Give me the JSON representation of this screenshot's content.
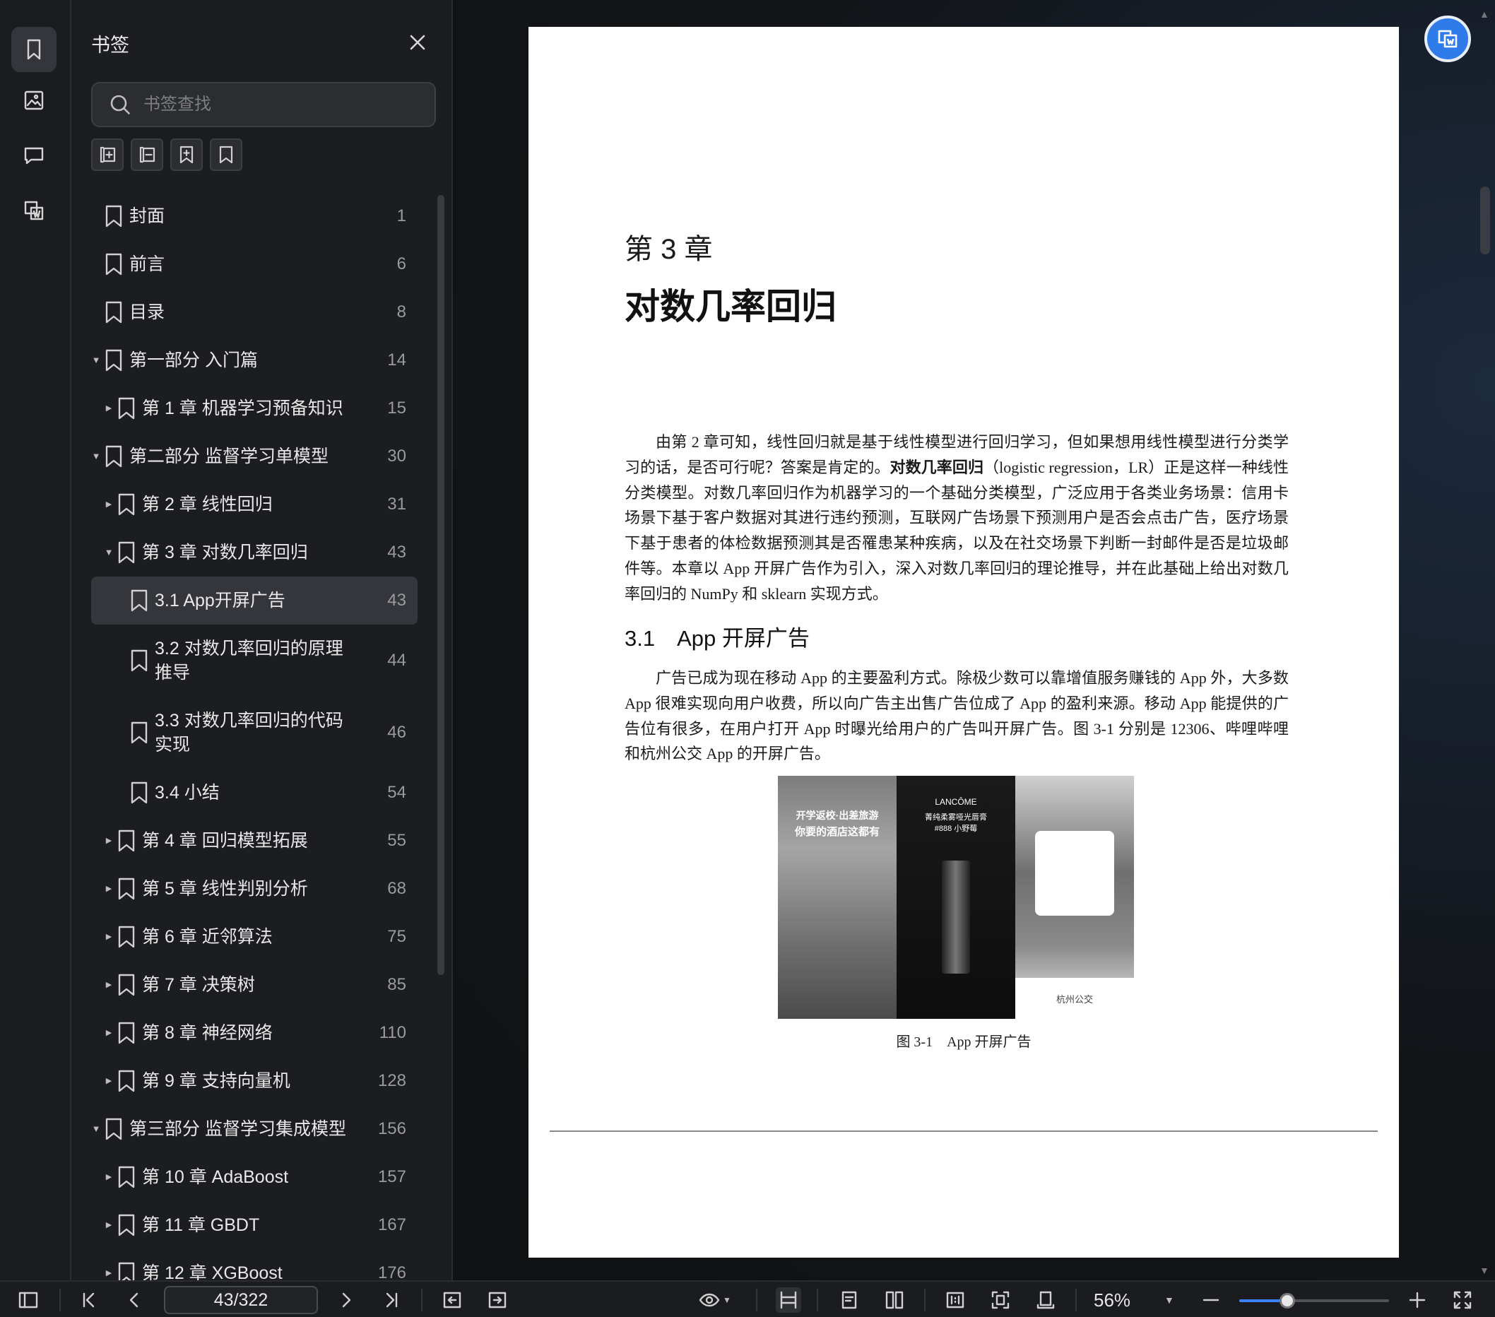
{
  "panel": {
    "title": "书签",
    "search_placeholder": "书签查找",
    "tools": [
      "expand-all-icon",
      "collapse-all-icon",
      "add-bookmark-icon",
      "bookmark-icon"
    ]
  },
  "bookmarks": [
    {
      "label": "封面",
      "page": "1",
      "level": 0,
      "arrow": ""
    },
    {
      "label": "前言",
      "page": "6",
      "level": 0,
      "arrow": ""
    },
    {
      "label": "目录",
      "page": "8",
      "level": 0,
      "arrow": ""
    },
    {
      "label": "第一部分 入门篇",
      "page": "14",
      "level": 0,
      "arrow": "down"
    },
    {
      "label": "第 1 章 机器学习预备知识",
      "page": "15",
      "level": 1,
      "arrow": "right"
    },
    {
      "label": "第二部分 监督学习单模型",
      "page": "30",
      "level": 0,
      "arrow": "down"
    },
    {
      "label": "第 2 章 线性回归",
      "page": "31",
      "level": 1,
      "arrow": "right"
    },
    {
      "label": "第 3 章 对数几率回归",
      "page": "43",
      "level": 1,
      "arrow": "down"
    },
    {
      "label": "3.1 App开屏广告",
      "page": "43",
      "level": 2,
      "arrow": "",
      "selected": true
    },
    {
      "label": "3.2 对数几率回归的原理推导",
      "page": "44",
      "level": 2,
      "arrow": "",
      "tall": true
    },
    {
      "label": "3.3 对数几率回归的代码实现",
      "page": "46",
      "level": 2,
      "arrow": "",
      "tall": true
    },
    {
      "label": "3.4 小结",
      "page": "54",
      "level": 2,
      "arrow": ""
    },
    {
      "label": "第 4 章 回归模型拓展",
      "page": "55",
      "level": 1,
      "arrow": "right"
    },
    {
      "label": "第 5 章 线性判别分析",
      "page": "68",
      "level": 1,
      "arrow": "right"
    },
    {
      "label": "第 6 章 近邻算法",
      "page": "75",
      "level": 1,
      "arrow": "right"
    },
    {
      "label": "第 7 章 决策树",
      "page": "85",
      "level": 1,
      "arrow": "right"
    },
    {
      "label": "第 8 章 神经网络",
      "page": "110",
      "level": 1,
      "arrow": "right"
    },
    {
      "label": "第 9 章 支持向量机",
      "page": "128",
      "level": 1,
      "arrow": "right"
    },
    {
      "label": "第三部分 监督学习集成模型",
      "page": "156",
      "level": 0,
      "arrow": "down"
    },
    {
      "label": "第 10 章 AdaBoost",
      "page": "157",
      "level": 1,
      "arrow": "right"
    },
    {
      "label": "第 11 章 GBDT",
      "page": "167",
      "level": 1,
      "arrow": "right"
    },
    {
      "label": "第 12 章 XGBoost",
      "page": "176",
      "level": 1,
      "arrow": "right"
    }
  ],
  "document": {
    "chapter_number": "第 3 章",
    "chapter_title": "对数几率回归",
    "para1_a": "由第 2 章可知，线性回归就是基于线性模型进行回归学习，但如果想用线性模型进行分类学习的话，是否可行呢？答案是肯定的。",
    "para1_bold": "对数几率回归",
    "para1_b": "（logistic regression，LR）正是这样一种线性分类模型。对数几率回归作为机器学习的一个基础分类模型，广泛应用于各类业务场景：信用卡场景下基于客户数据对其进行违约预测，互联网广告场景下预测用户是否会点击广告，医疗场景下基于患者的体检数据预测其是否罹患某种疾病，以及在社交场景下判断一封邮件是否是垃圾邮件等。本章以 App 开屏广告作为引入，深入对数几率回归的理论推导，并在此基础上给出对数几率回归的 NumPy 和 sklearn 实现方式。",
    "section_title": "3.1　App 开屏广告",
    "para2": "广告已成为现在移动 App 的主要盈利方式。除极少数可以靠增值服务赚钱的 App 外，大多数 App 很难实现向用户收费，所以向广告主出售广告位成了 App 的盈利来源。移动 App 能提供的广告位有很多，在用户打开 App 时曝光给用户的广告叫开屏广告。图 3-1 分别是 12306、哔哩哔哩和杭州公交 App 的开屏广告。",
    "figure_caption": "图 3-1　App 开屏广告",
    "ad1_line1": "开学返校·出差旅游",
    "ad1_line2": "你要的酒店这都有",
    "ad2_brand": "LANCÔME",
    "ad2_line1": "菁纯柔雾哑光唇膏",
    "ad2_line2": "#888 小野莓",
    "ad3_label": "杭州公交"
  },
  "toolbar": {
    "page_indicator": "43/322",
    "zoom": "56%",
    "zoom_level": 0.32
  }
}
